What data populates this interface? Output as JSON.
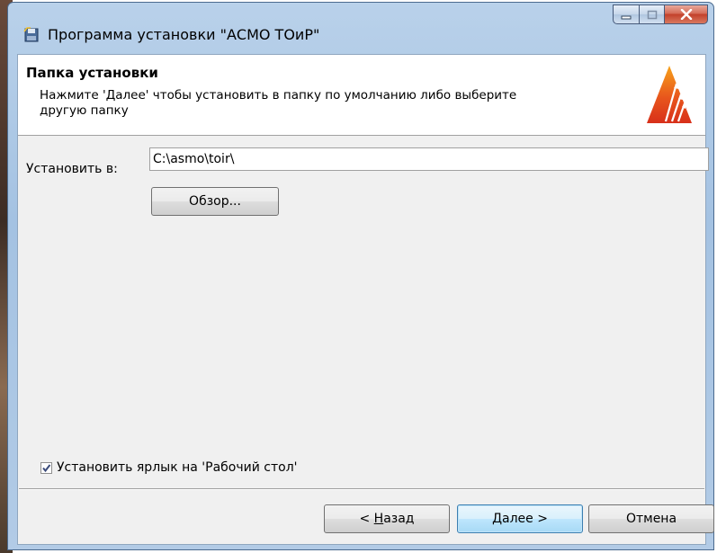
{
  "window": {
    "title": "Программа установки \"АСМО ТОиР\""
  },
  "header": {
    "title": "Папка установки",
    "description": "Нажмите 'Далее' чтобы установить в папку по умолчанию либо выберите другую папку"
  },
  "install_path": {
    "label": "Установить в:",
    "value": "C:\\asmo\\toir\\"
  },
  "browse_button": {
    "label": "Обзор..."
  },
  "desktop_shortcut": {
    "label": "Установить ярлык на 'Рабочий стол'",
    "checked": true
  },
  "buttons": {
    "back_prefix": "< ",
    "back_mnemonic": "Н",
    "back_rest": "азад",
    "next": "Далее >",
    "cancel": "Отмена"
  },
  "icons": {
    "app": "installer-disk-icon",
    "logo": "asmo-logo-icon",
    "minimize": "minimize-icon",
    "maximize": "maximize-icon",
    "close": "close-icon",
    "check": "checkmark-icon"
  },
  "colors": {
    "logo_orange": "#e8561c",
    "logo_red": "#d8301a",
    "close_red": "#c2402a",
    "default_button_border": "#3c7fb1"
  }
}
